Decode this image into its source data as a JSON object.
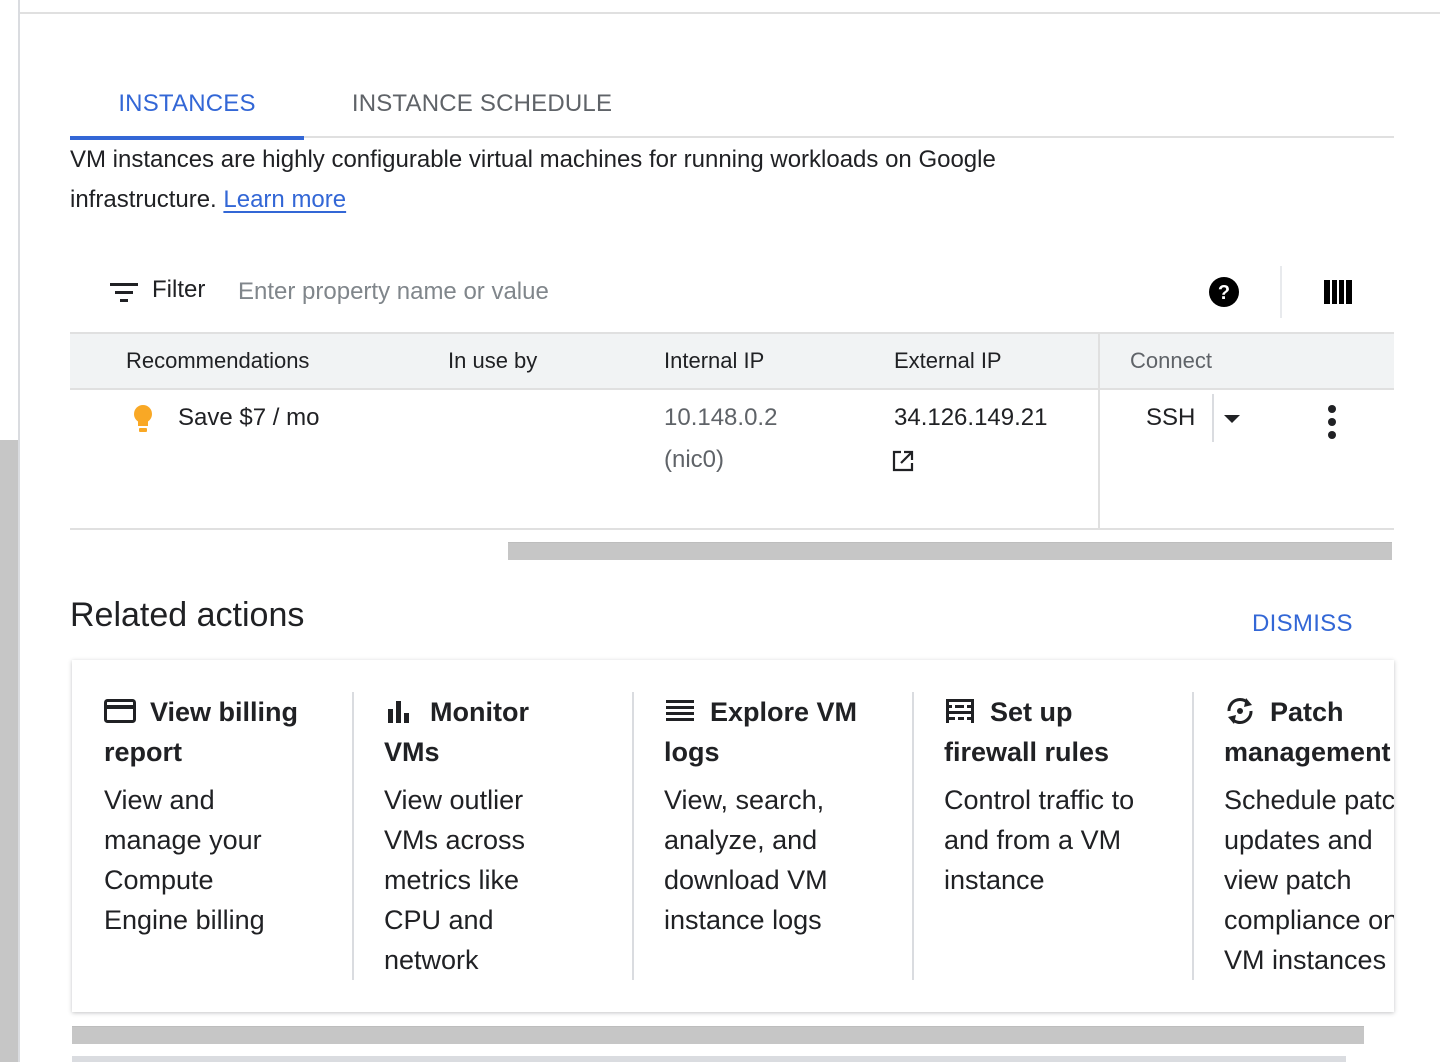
{
  "tabs": {
    "instances": "INSTANCES",
    "schedule": "INSTANCE SCHEDULE"
  },
  "description": {
    "text": "VM instances are highly configurable virtual machines for running workloads on Google infrastructure. ",
    "link": "Learn more"
  },
  "filter": {
    "label": "Filter",
    "placeholder": "Enter property name or value",
    "icons": [
      "filter-icon",
      "help-icon",
      "columns-icon"
    ]
  },
  "table": {
    "headers": {
      "recommendations": "Recommendations",
      "in_use_by": "In use by",
      "internal_ip": "Internal IP",
      "external_ip": "External IP",
      "connect": "Connect"
    },
    "rows": [
      {
        "recommendation": "Save $7 / mo",
        "in_use_by": "",
        "internal_ip": "10.148.0.2",
        "internal_nic": "(nic0)",
        "external_ip": "34.126.149.21",
        "connect": "SSH"
      }
    ]
  },
  "related_actions": {
    "title": "Related actions",
    "dismiss": "DISMISS",
    "cards": [
      {
        "icon": "credit-card-icon",
        "title_line1": "View billing",
        "title_line2": "report",
        "desc": "View and\nmanage your\nCompute\nEngine billing"
      },
      {
        "icon": "bar-chart-icon",
        "title_line1": "Monitor",
        "title_line2": "VMs",
        "desc": "View outlier\nVMs across\nmetrics like\nCPU and\nnetwork"
      },
      {
        "icon": "logs-list-icon",
        "title_line1": "Explore VM",
        "title_line2": "logs",
        "desc": "View, search,\nanalyze, and\ndownload VM\ninstance logs"
      },
      {
        "icon": "firewall-icon",
        "title_line1": "Set up",
        "title_line2": "firewall rules",
        "desc": "Control traffic to\nand from a VM\ninstance"
      },
      {
        "icon": "patch-sync-icon",
        "title_line1": "Patch",
        "title_line2": "management",
        "desc": "Schedule patch\nupdates and\nview patch\ncompliance on\nVM instances"
      }
    ]
  },
  "colors": {
    "accent": "#3367d6",
    "bulb": "#f9a825",
    "text": "#202124",
    "muted": "#5f6368"
  }
}
